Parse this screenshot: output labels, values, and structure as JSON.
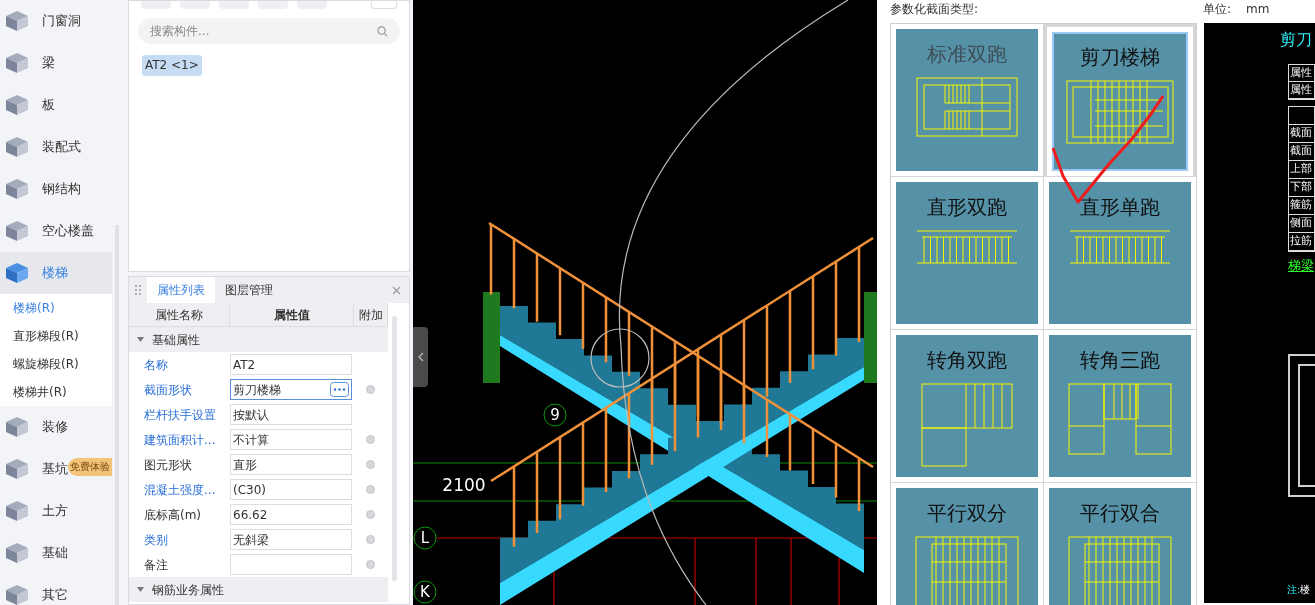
{
  "sidebar": {
    "items": [
      {
        "label": "门窗洞",
        "selected": false
      },
      {
        "label": "梁",
        "selected": false
      },
      {
        "label": "板",
        "selected": false
      },
      {
        "label": "装配式",
        "selected": false
      },
      {
        "label": "钢结构",
        "selected": false
      },
      {
        "label": "空心楼盖",
        "selected": false
      },
      {
        "label": "楼梯",
        "selected": true,
        "children": [
          {
            "label": "楼梯(R)",
            "selected": true
          },
          {
            "label": "直形梯段(R)",
            "selected": false
          },
          {
            "label": "螺旋梯段(R)",
            "selected": false
          },
          {
            "label": "楼梯井(R)",
            "selected": false
          }
        ]
      },
      {
        "label": "装修",
        "selected": false
      },
      {
        "label": "基坑",
        "selected": false,
        "badge": "免费体验"
      },
      {
        "label": "土方",
        "selected": false
      },
      {
        "label": "基础",
        "selected": false
      },
      {
        "label": "其它",
        "selected": false
      }
    ]
  },
  "component_list": {
    "search": {
      "placeholder": "搜索构件..."
    },
    "items": [
      {
        "label": "AT2 <1>",
        "selected": true
      }
    ]
  },
  "properties": {
    "tabs": [
      {
        "label": "属性列表",
        "selected": true
      },
      {
        "label": "图层管理",
        "selected": false
      }
    ],
    "columns": [
      "属性名称",
      "属性值",
      "附加"
    ],
    "groups": [
      {
        "title": "基础属性",
        "expanded": true,
        "rows": [
          {
            "name": "名称",
            "linked": true,
            "value": "AT2",
            "extra": false,
            "focused": false
          },
          {
            "name": "截面形状",
            "linked": true,
            "value": "剪刀楼梯",
            "extra": true,
            "focused": true
          },
          {
            "name": "栏杆扶手设置",
            "linked": true,
            "value": "按默认",
            "extra": false,
            "focused": false
          },
          {
            "name": "建筑面积计...",
            "linked": true,
            "value": "不计算",
            "extra": true,
            "focused": false
          },
          {
            "name": "图元形状",
            "linked": false,
            "value": "直形",
            "extra": true,
            "focused": false
          },
          {
            "name": "混凝土强度...",
            "linked": true,
            "value": "(C30)",
            "extra": true,
            "focused": false
          },
          {
            "name": "底标高(m)",
            "linked": false,
            "value": "66.62",
            "extra": true,
            "focused": false
          },
          {
            "name": "类别",
            "linked": true,
            "value": "无斜梁",
            "extra": true,
            "focused": false
          },
          {
            "name": "备注",
            "linked": false,
            "extra": true,
            "focused": false
          }
        ]
      },
      {
        "title": "钢筋业务属性",
        "expanded": true
      }
    ]
  },
  "viewport": {
    "dimension": "2100",
    "axis_labels": [
      "9",
      "L",
      "K"
    ]
  },
  "section_types": {
    "title": "参数化截面类型:",
    "unit_label": "单位:",
    "unit": "mm",
    "items": [
      {
        "label": "标准双跑",
        "kind": "double",
        "selected": false
      },
      {
        "label": "剪刀楼梯",
        "kind": "scissor",
        "selected": true
      },
      {
        "label": "直形双跑",
        "kind": "straight",
        "selected": false
      },
      {
        "label": "直形单跑",
        "kind": "straight",
        "selected": false
      },
      {
        "label": "转角双跑",
        "kind": "corner2",
        "selected": false
      },
      {
        "label": "转角三跑",
        "kind": "corner3",
        "selected": false
      },
      {
        "label": "平行双分",
        "kind": "parallel",
        "selected": false
      },
      {
        "label": "平行双合",
        "kind": "parallel",
        "selected": false
      }
    ]
  },
  "preview": {
    "title": "剪刀",
    "head_rows": [
      "属性",
      "属性"
    ],
    "rows": [
      "截面",
      "截面",
      "上部",
      "下部",
      "箍筋",
      "侧面",
      "拉筋"
    ],
    "link": "梯梁",
    "note": "注:",
    "note_text": "楼"
  }
}
